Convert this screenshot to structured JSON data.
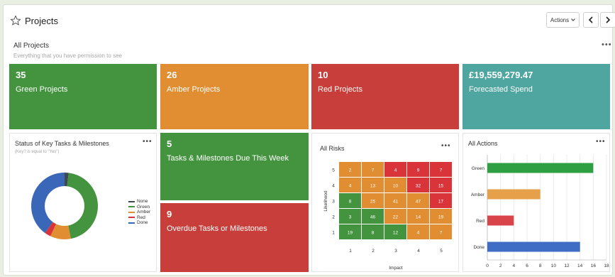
{
  "header": {
    "title": "Projects",
    "actions_label": "Actions",
    "prev_glyph": "❮",
    "next_glyph": "❯"
  },
  "section": {
    "title": "All Projects",
    "subtitle": "Everything that you have permission to see",
    "menu_glyph": "•••"
  },
  "tiles": {
    "green": {
      "value": "35",
      "label": "Green Projects",
      "color": "#43933f"
    },
    "amber": {
      "value": "26",
      "label": "Amber Projects",
      "color": "#e18d32"
    },
    "red": {
      "value": "10",
      "label": "Red Projects",
      "color": "#c73e3a"
    },
    "spend": {
      "value": "£19,559,279.47",
      "label": "Forecasted Spend",
      "color": "#4fa6a0"
    },
    "due": {
      "value": "5",
      "label": "Tasks & Milestones Due This Week",
      "color": "#43933f"
    },
    "overdue": {
      "value": "9",
      "label": "Overdue Tasks or Milestones",
      "color": "#c73e3a"
    }
  },
  "key_tasks": {
    "title": "Status of Key Tasks & Milestones",
    "filter": "(Key? is equal to \"Yes\")",
    "menu_glyph": "•••",
    "chart_data": {
      "type": "pie",
      "donut": true,
      "legend_position": "right",
      "labels": [
        "None",
        "Green",
        "Amber",
        "Red",
        "Done"
      ],
      "values": [
        2,
        45,
        10,
        3,
        40
      ],
      "colors": [
        "#3d4a52",
        "#43933f",
        "#e18d32",
        "#d9343a",
        "#3b67b8"
      ]
    }
  },
  "risks": {
    "title": "All Risks",
    "menu_glyph": "•••",
    "chart_data": {
      "type": "heatmap",
      "xlabel": "Impact",
      "ylabel": "Likelihood",
      "x": [
        1,
        2,
        3,
        4,
        5
      ],
      "y": [
        1,
        2,
        3,
        4,
        5
      ],
      "rows": [
        {
          "likelihood": 5,
          "values": [
            2,
            7,
            4,
            9,
            7
          ],
          "colors": [
            "#e18d32",
            "#e18d32",
            "#d9343a",
            "#d9343a",
            "#d9343a"
          ]
        },
        {
          "likelihood": 4,
          "values": [
            4,
            13,
            10,
            32,
            15
          ],
          "colors": [
            "#e18d32",
            "#e18d32",
            "#e18d32",
            "#d9343a",
            "#d9343a"
          ]
        },
        {
          "likelihood": 3,
          "values": [
            8,
            25,
            41,
            47,
            17
          ],
          "colors": [
            "#43933f",
            "#e18d32",
            "#e18d32",
            "#e18d32",
            "#d9343a"
          ]
        },
        {
          "likelihood": 2,
          "values": [
            3,
            46,
            22,
            14,
            19
          ],
          "colors": [
            "#43933f",
            "#43933f",
            "#e18d32",
            "#e18d32",
            "#e18d32"
          ]
        },
        {
          "likelihood": 1,
          "values": [
            19,
            8,
            12,
            4,
            7
          ],
          "colors": [
            "#43933f",
            "#43933f",
            "#43933f",
            "#e18d32",
            "#e18d32"
          ]
        }
      ]
    }
  },
  "actions": {
    "title": "All Actions",
    "menu_glyph": "•••",
    "chart_data": {
      "type": "bar",
      "orientation": "horizontal",
      "categories": [
        "Green",
        "Amber",
        "Red",
        "Done"
      ],
      "values": [
        16,
        8,
        4,
        14
      ],
      "colors": [
        "#2ea043",
        "#e6a04a",
        "#d9434a",
        "#3f6cc4"
      ],
      "xlim": [
        0,
        18
      ],
      "xticks": [
        0,
        2,
        4,
        6,
        8,
        10,
        12,
        14,
        16,
        18
      ],
      "grid": true
    }
  }
}
